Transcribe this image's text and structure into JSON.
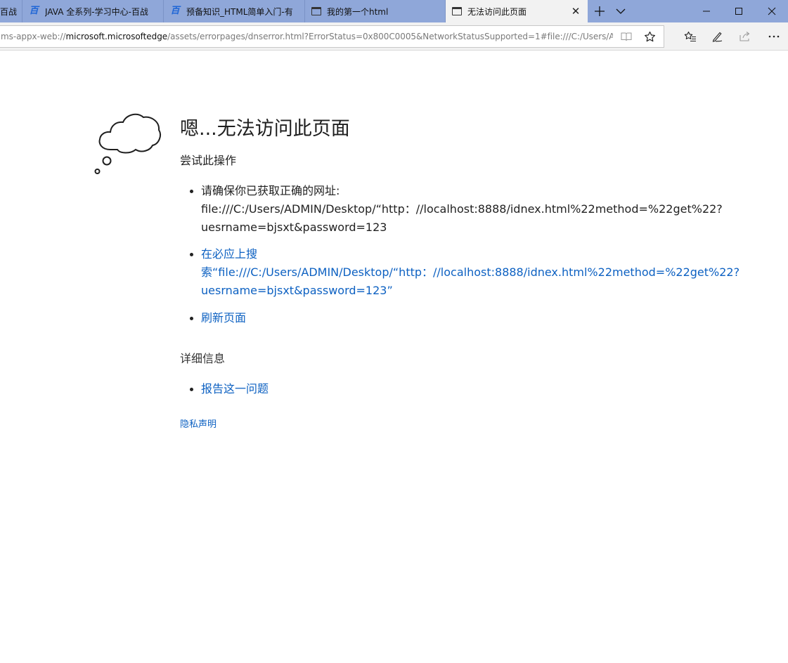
{
  "tabs": [
    {
      "label": "百战",
      "icon": "baizhan-e-icon"
    },
    {
      "label": "JAVA 全系列-学习中心-百战",
      "icon": "baizhan-e-icon"
    },
    {
      "label": "预备知识_HTML简单入门-有",
      "icon": "baizhan-e-icon"
    },
    {
      "label": "我的第一个html",
      "icon": "page-icon"
    },
    {
      "label": "无法访问此页面",
      "icon": "page-icon",
      "active": true
    }
  ],
  "address": {
    "scheme": "ms-appx-web://",
    "host": "microsoft.microsoftedge",
    "path": "/assets/errorpages/dnserror.html?ErrorStatus=0x800C0005&NetworkStatusSupported=1#file:///C:/Users/ADMIN/Deskt"
  },
  "error_page": {
    "title": "嗯...无法访问此页面",
    "try_heading": "尝试此操作",
    "bullet_url_label": "请确保你已获取正确的网址:",
    "bullet_url_line1": "file:///C:/Users/ADMIN/Desktop/“http：//localhost:8888/idnex.html%22method=%22get%22?",
    "bullet_url_line2": "uesrname=bjsxt&password=123",
    "search_line1": "在必应上搜",
    "search_line2": "索“file:///C:/Users/ADMIN/Desktop/“http：//localhost:8888/idnex.html%22method=%22get%22?",
    "search_line3": "uesrname=bjsxt&password=123”",
    "refresh_link": "刷新页面",
    "details_heading": "详细信息",
    "report_link": "报告这一问题",
    "privacy_link": "隐私声明"
  },
  "colors": {
    "tabstrip": "#8fa7d9",
    "link": "#0d61c2"
  }
}
